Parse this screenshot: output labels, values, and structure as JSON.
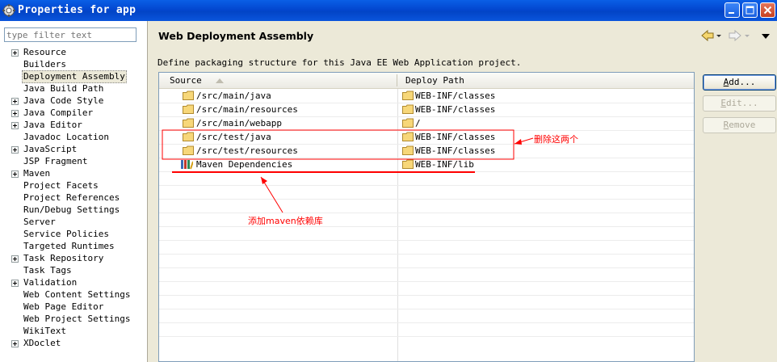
{
  "window": {
    "title": "Properties for app",
    "icon": "gear-icon"
  },
  "filter": {
    "placeholder": "type filter text"
  },
  "tree": {
    "items": [
      {
        "label": "Resource",
        "expandable": true
      },
      {
        "label": "Builders",
        "expandable": false
      },
      {
        "label": "Deployment Assembly",
        "expandable": false,
        "selected": true
      },
      {
        "label": "Java Build Path",
        "expandable": false
      },
      {
        "label": "Java Code Style",
        "expandable": true
      },
      {
        "label": "Java Compiler",
        "expandable": true
      },
      {
        "label": "Java Editor",
        "expandable": true
      },
      {
        "label": "Javadoc Location",
        "expandable": false
      },
      {
        "label": "JavaScript",
        "expandable": true
      },
      {
        "label": "JSP Fragment",
        "expandable": false
      },
      {
        "label": "Maven",
        "expandable": true
      },
      {
        "label": "Project Facets",
        "expandable": false
      },
      {
        "label": "Project References",
        "expandable": false
      },
      {
        "label": "Run/Debug Settings",
        "expandable": false
      },
      {
        "label": "Server",
        "expandable": false
      },
      {
        "label": "Service Policies",
        "expandable": false
      },
      {
        "label": "Targeted Runtimes",
        "expandable": false
      },
      {
        "label": "Task Repository",
        "expandable": true
      },
      {
        "label": "Task Tags",
        "expandable": false
      },
      {
        "label": "Validation",
        "expandable": true
      },
      {
        "label": "Web Content Settings",
        "expandable": false
      },
      {
        "label": "Web Page Editor",
        "expandable": false
      },
      {
        "label": "Web Project Settings",
        "expandable": false
      },
      {
        "label": "WikiText",
        "expandable": false
      },
      {
        "label": "XDoclet",
        "expandable": true
      }
    ]
  },
  "page": {
    "title": "Web Deployment Assembly",
    "description": "Define packaging structure for this Java EE Web Application project."
  },
  "table": {
    "columns": [
      "Source",
      "Deploy Path"
    ],
    "rows": [
      {
        "source": "/src/main/java",
        "deploy": "WEB-INF/classes",
        "icon": "folder-icon"
      },
      {
        "source": "/src/main/resources",
        "deploy": "WEB-INF/classes",
        "icon": "folder-icon"
      },
      {
        "source": "/src/main/webapp",
        "deploy": "/",
        "icon": "folder-icon"
      },
      {
        "source": "/src/test/java",
        "deploy": "WEB-INF/classes",
        "icon": "folder-icon"
      },
      {
        "source": "/src/test/resources",
        "deploy": "WEB-INF/classes",
        "icon": "folder-icon"
      },
      {
        "source": "Maven Dependencies",
        "deploy": "WEB-INF/lib",
        "icon": "library-icon"
      }
    ],
    "empty_rows": 12
  },
  "buttons": {
    "add": "Add...",
    "edit": "Edit...",
    "remove": "Remove"
  },
  "annotations": {
    "delete_note": "删除这两个",
    "add_note": "添加maven依赖库",
    "color": "#ff0000"
  },
  "colors": {
    "titlebar": "#0a5fe6",
    "dialog_bg": "#ece9d8",
    "selection": "#ece9d8",
    "annotation": "#ff0000"
  }
}
